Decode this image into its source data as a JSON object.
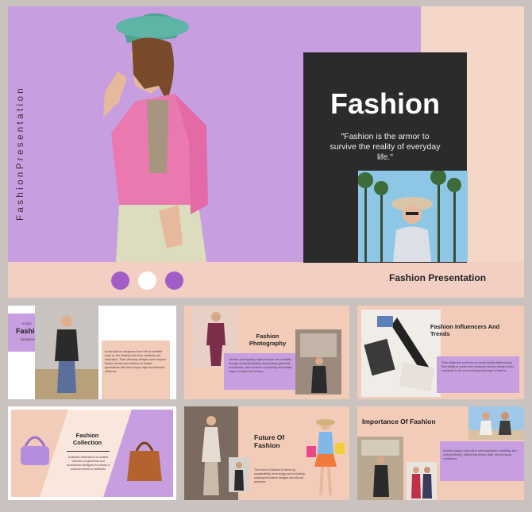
{
  "hero": {
    "vertical_text": "FashionPresentation",
    "title": "Fashion",
    "quote": "\"Fashion is the armor to survive the reality of everyday life.\"",
    "footer_label": "Fashion Presentation",
    "dots": [
      "#a45cc8",
      "#ffffff",
      "#a45cc8"
    ]
  },
  "thumbs": {
    "t1": {
      "small": "Iconic",
      "title": "Fashion",
      "subtitle": "Designers",
      "body": "Iconic fashion designers have left an indelible mark on the industry with their creativity and innovation. Their visionary designs have shaped fashion trends and continue to inspire generations with their unique style and timeless influence."
    },
    "t2": {
      "title": "Fashion Photography",
      "body": "Fashion photography captures style and creativity through visual storytelling, showcasing garments, accessories, and models in compelling and artistic ways to inspire the industry."
    },
    "t3": {
      "title": "Fashion Influencers And Trends",
      "body": "Their influencer presence on social media platforms and their ability to curate and showcase fashion forward looks contribute to the ever-evolving landscape of fashion."
    },
    "t4": {
      "title": "Fashion Collection",
      "body": "A fashion collection is a curated selection of garments and accessories designed to convey a cohesive theme or aesthetic."
    },
    "t5": {
      "title": "Future Of Fashion",
      "body": "The future of fashion is driven by sustainability, technology, and inclusivity, shaping innovative designs and ethical practices."
    },
    "t6": {
      "title": "Importance Of Fashion",
      "body": "Fashion plays a vital role in self-expression, creativity, and cultural identity, influencing trends, style, and personal confidence."
    }
  },
  "colors": {
    "purple": "#c79fe0",
    "peach": "#f2cfc2",
    "dark": "#2b2b2b",
    "accent": "#a45cc8"
  }
}
